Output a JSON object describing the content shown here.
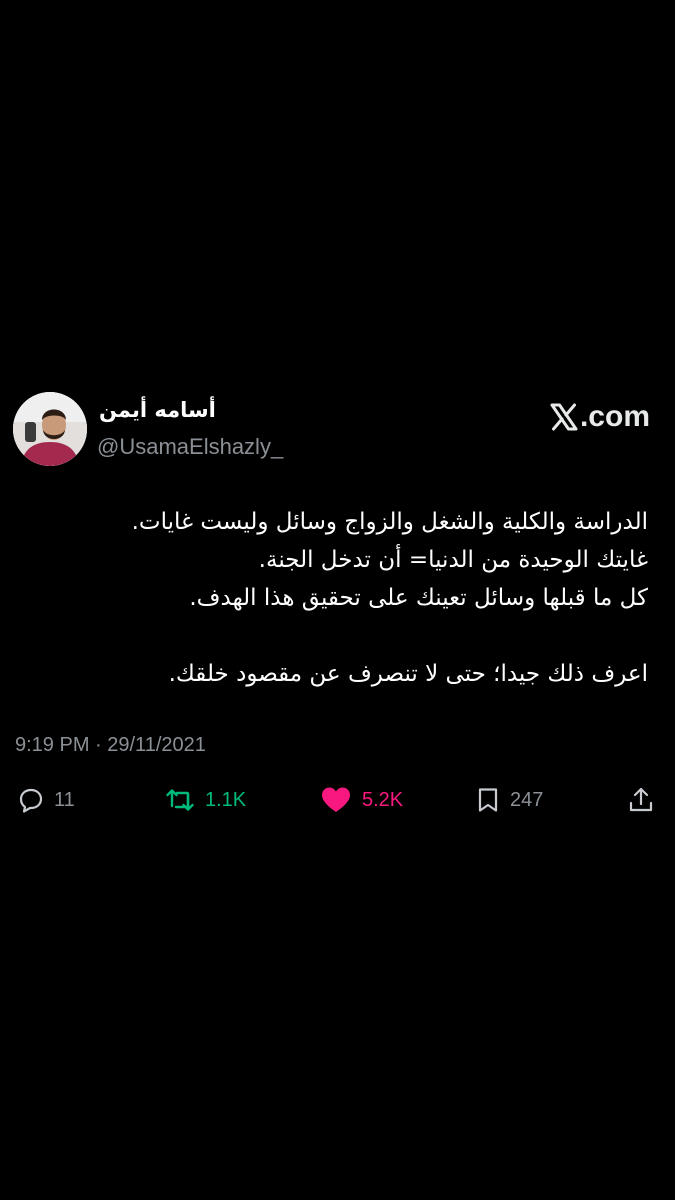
{
  "brand": {
    "icon": "x-logo-icon",
    "domain": ".com"
  },
  "author": {
    "display_name": "أسامه أيمن",
    "handle": "@UsamaElshazly_",
    "avatar_icon": "avatar"
  },
  "tweet": {
    "lines": [
      "الدراسة والكلية والشغل والزواج وسائل وليست غايات.",
      "غايتك الوحيدة من الدنيا= أن تدخل الجنة.",
      "كل ما قبلها وسائل تعينك على تحقيق هذا الهدف.",
      "",
      "اعرف ذلك جيدا؛ حتى لا تنصرف عن مقصود خلقك."
    ],
    "timestamp": "9:19 PM · 29/11/2021"
  },
  "actions": {
    "reply": {
      "icon": "reply-icon",
      "count": "11"
    },
    "retweet": {
      "icon": "retweet-icon",
      "count": "1.1K",
      "color": "#00ba7c"
    },
    "like": {
      "icon": "heart-icon",
      "count": "5.2K",
      "color": "#f91880"
    },
    "bookmark": {
      "icon": "bookmark-icon",
      "count": "247"
    },
    "share": {
      "icon": "share-icon"
    }
  },
  "colors": {
    "background": "#000000",
    "text": "#ffffff",
    "muted": "#8b9096"
  }
}
